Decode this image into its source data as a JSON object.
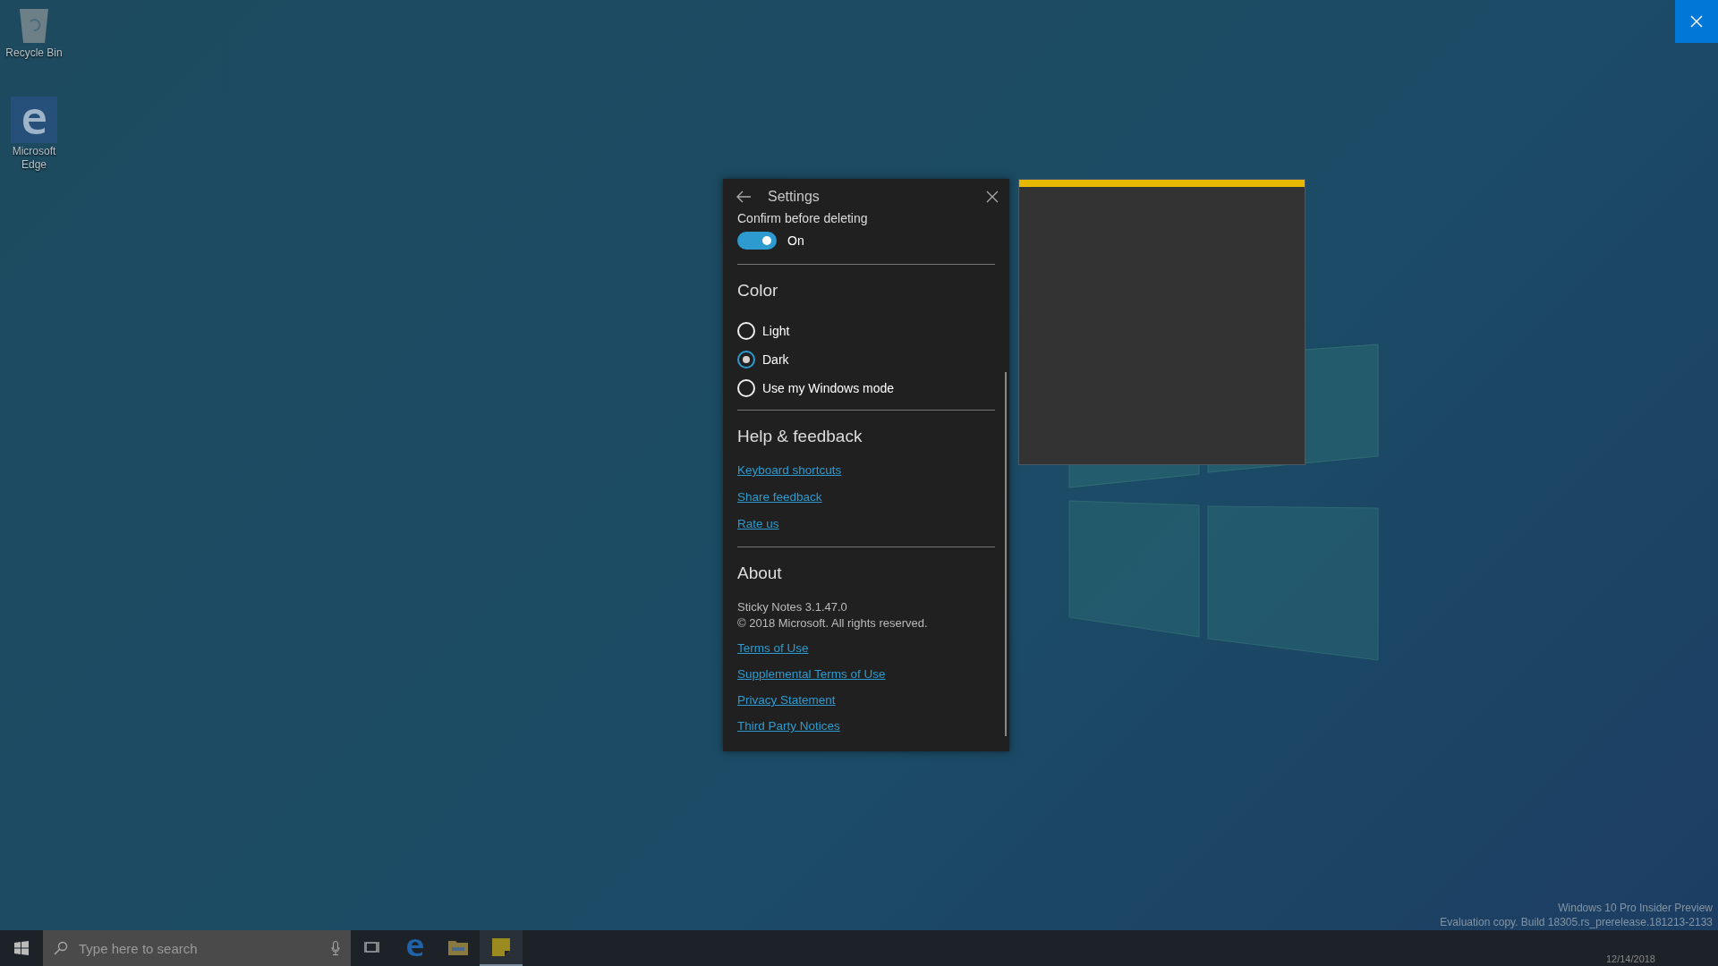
{
  "desktop_icons": [
    {
      "kind": "recycle",
      "label": "Recycle Bin"
    },
    {
      "kind": "edge",
      "label": "Microsoft Edge"
    }
  ],
  "settings": {
    "title": "Settings",
    "confirm_label": "Confirm before deleting",
    "toggle": {
      "on": true,
      "label": "On"
    },
    "color": {
      "heading": "Color",
      "options": [
        {
          "label": "Light",
          "selected": false
        },
        {
          "label": "Dark",
          "selected": true
        },
        {
          "label": "Use my Windows mode",
          "selected": false
        }
      ]
    },
    "help": {
      "heading": "Help & feedback",
      "links": [
        "Keyboard shortcuts",
        "Share feedback",
        "Rate us"
      ]
    },
    "about": {
      "heading": "About",
      "version": "Sticky Notes 3.1.47.0",
      "copyright": "© 2018 Microsoft. All rights reserved.",
      "links": [
        "Terms of Use",
        "Supplemental Terms of Use",
        "Privacy Statement",
        "Third Party Notices"
      ]
    }
  },
  "taskbar": {
    "search_placeholder": "Type here to search",
    "apps": [
      {
        "kind": "taskview",
        "active": false
      },
      {
        "kind": "edge",
        "active": false
      },
      {
        "kind": "explorer",
        "active": false
      },
      {
        "kind": "notes",
        "active": true
      }
    ],
    "date": "12/14/2018"
  },
  "build_info": [
    "Windows 10 Pro Insider Preview",
    "Evaluation copy. Build 18305.rs_prerelease.181213-2133"
  ]
}
